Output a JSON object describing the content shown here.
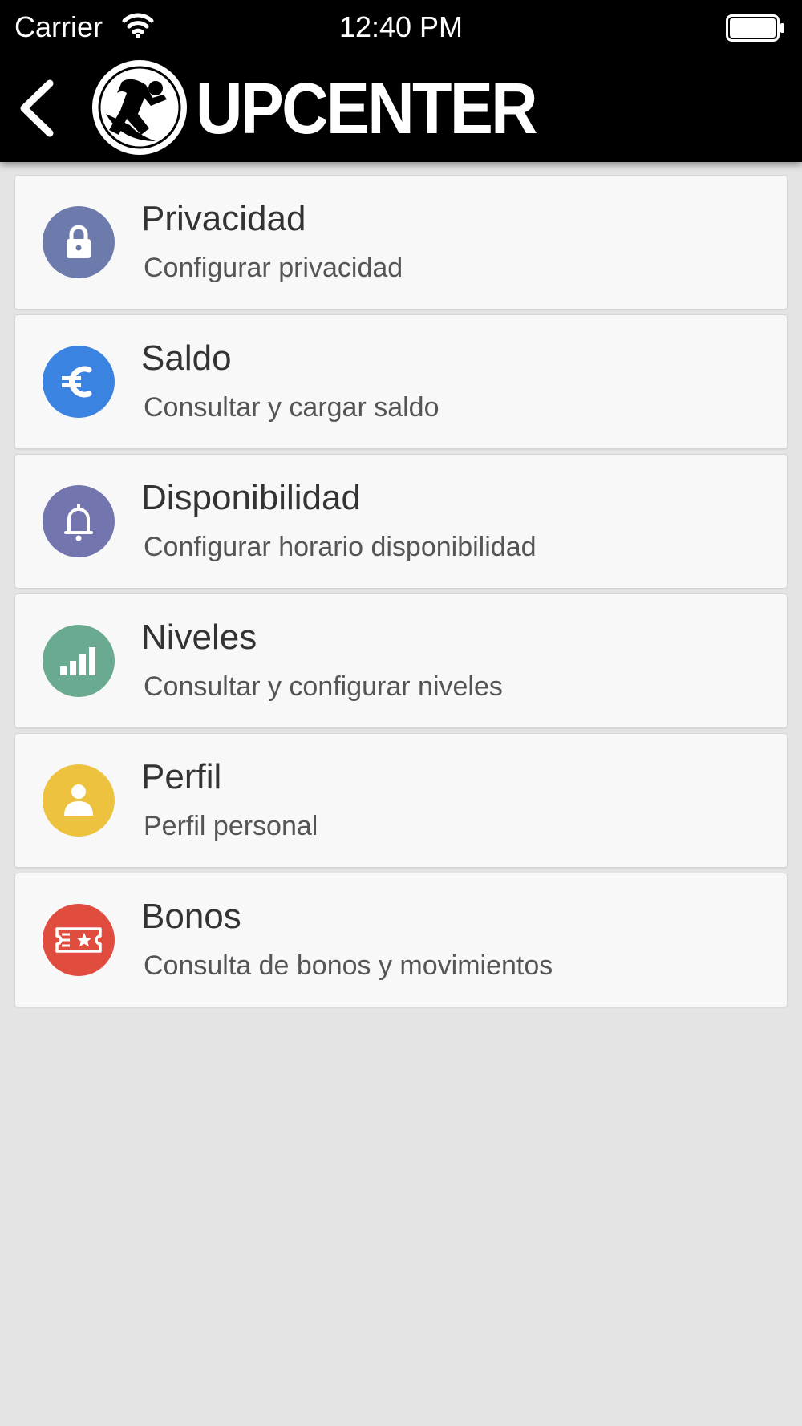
{
  "status_bar": {
    "carrier": "Carrier",
    "time": "12:40 PM"
  },
  "header": {
    "logo_text": "UPCENTER"
  },
  "menu": {
    "items": [
      {
        "title": "Privacidad",
        "subtitle": "Configurar privacidad",
        "icon": "lock-icon",
        "color": "#6d7aac"
      },
      {
        "title": "Saldo",
        "subtitle": "Consultar y cargar saldo",
        "icon": "euro-icon",
        "color": "#3a83e0"
      },
      {
        "title": "Disponibilidad",
        "subtitle": "Configurar horario disponibilidad",
        "icon": "bell-icon",
        "color": "#7375ae"
      },
      {
        "title": "Niveles",
        "subtitle": "Consultar y configurar niveles",
        "icon": "signal-bars-icon",
        "color": "#6aaa90"
      },
      {
        "title": "Perfil",
        "subtitle": "Perfil personal",
        "icon": "user-icon",
        "color": "#ecc23f"
      },
      {
        "title": "Bonos",
        "subtitle": "Consulta de bonos y movimientos",
        "icon": "ticket-icon",
        "color": "#e04c3e"
      }
    ]
  }
}
